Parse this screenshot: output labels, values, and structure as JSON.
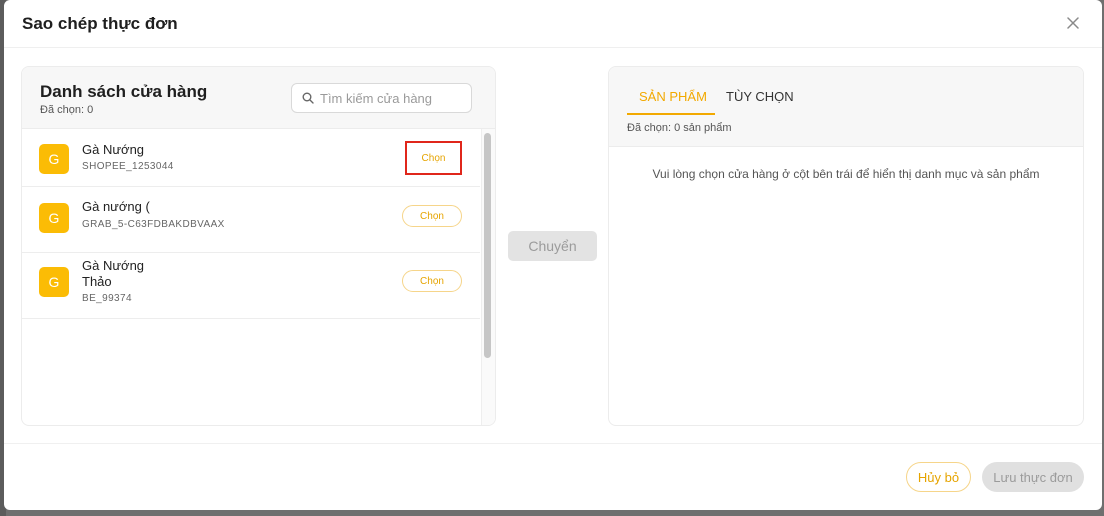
{
  "modal": {
    "title": "Sao chép thực đơn",
    "close_icon": "close-icon"
  },
  "left_panel": {
    "title": "Danh sách cửa hàng",
    "selected_label": "Đã chọn: 0",
    "search": {
      "placeholder": "Tìm kiếm cửa hàng",
      "value": ""
    },
    "stores": [
      {
        "avatar": "G",
        "name": "Gà Nướng",
        "code": "SHOPEE_1253044",
        "choose_label": "Chọn"
      },
      {
        "avatar": "G",
        "name": "Gà nướng (",
        "code": "GRAB_5-C63FDBAKDBVAAX",
        "choose_label": "Chọn"
      },
      {
        "avatar": "G",
        "name": "Gà Nướng Thảo",
        "code": "BE_99374",
        "choose_label": "Chọn"
      }
    ]
  },
  "transfer_label": "Chuyển",
  "right_panel": {
    "tabs": [
      {
        "label": "SẢN PHẨM",
        "active": true
      },
      {
        "label": "TÙY CHỌN",
        "active": false
      }
    ],
    "selected_label": "Đã chọn: 0 sản phẩm",
    "empty_message": "Vui lòng chọn cửa hàng ở cột bên trái để hiển thị danh mục và sản phẩm"
  },
  "footer": {
    "cancel_label": "Hủy bỏ",
    "save_label": "Lưu thực đơn"
  },
  "colors": {
    "accent": "#f2a900",
    "avatar": "#fbbc05",
    "highlight_box": "#e0261b"
  }
}
